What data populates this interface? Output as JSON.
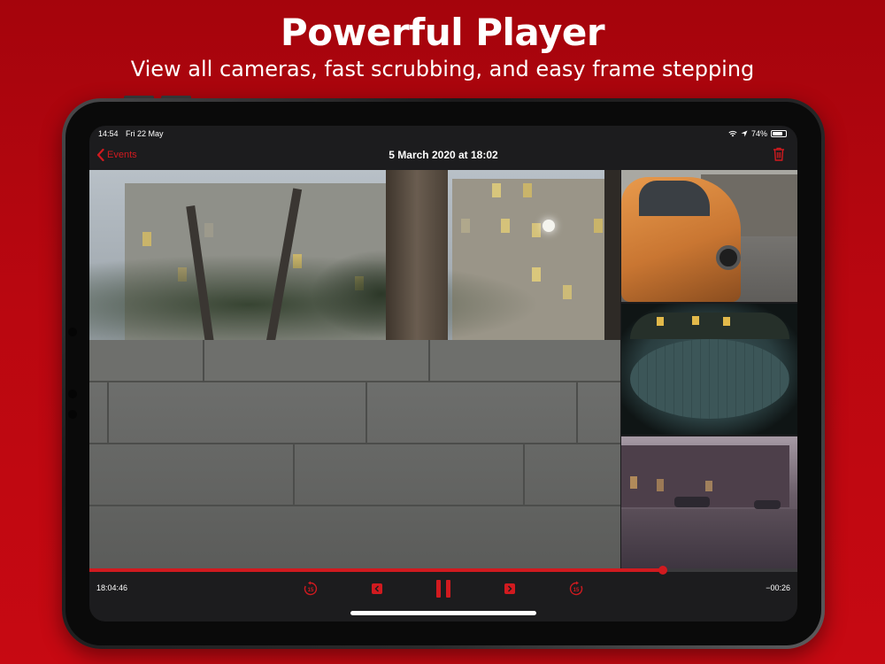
{
  "promo": {
    "headline": "Powerful Player",
    "subline": "View all cameras, fast scrubbing, and easy frame stepping"
  },
  "status_bar": {
    "time": "14:54",
    "date": "Fri 22 May",
    "battery": "74%"
  },
  "nav": {
    "back_label": "Events",
    "title": "5 March 2020 at 18:02",
    "delete_icon": "trash-icon"
  },
  "player": {
    "elapsed": "18:04:46",
    "remaining": "−00:26",
    "progress": 0.81,
    "controls": [
      "skip-back-15-icon",
      "frame-back-icon",
      "pause-icon",
      "frame-forward-icon",
      "skip-forward-15-icon"
    ],
    "skip_back_label": "15",
    "skip_forward_label": "15"
  },
  "colors": {
    "accent": "#d11a1f",
    "background": "#b90710"
  }
}
